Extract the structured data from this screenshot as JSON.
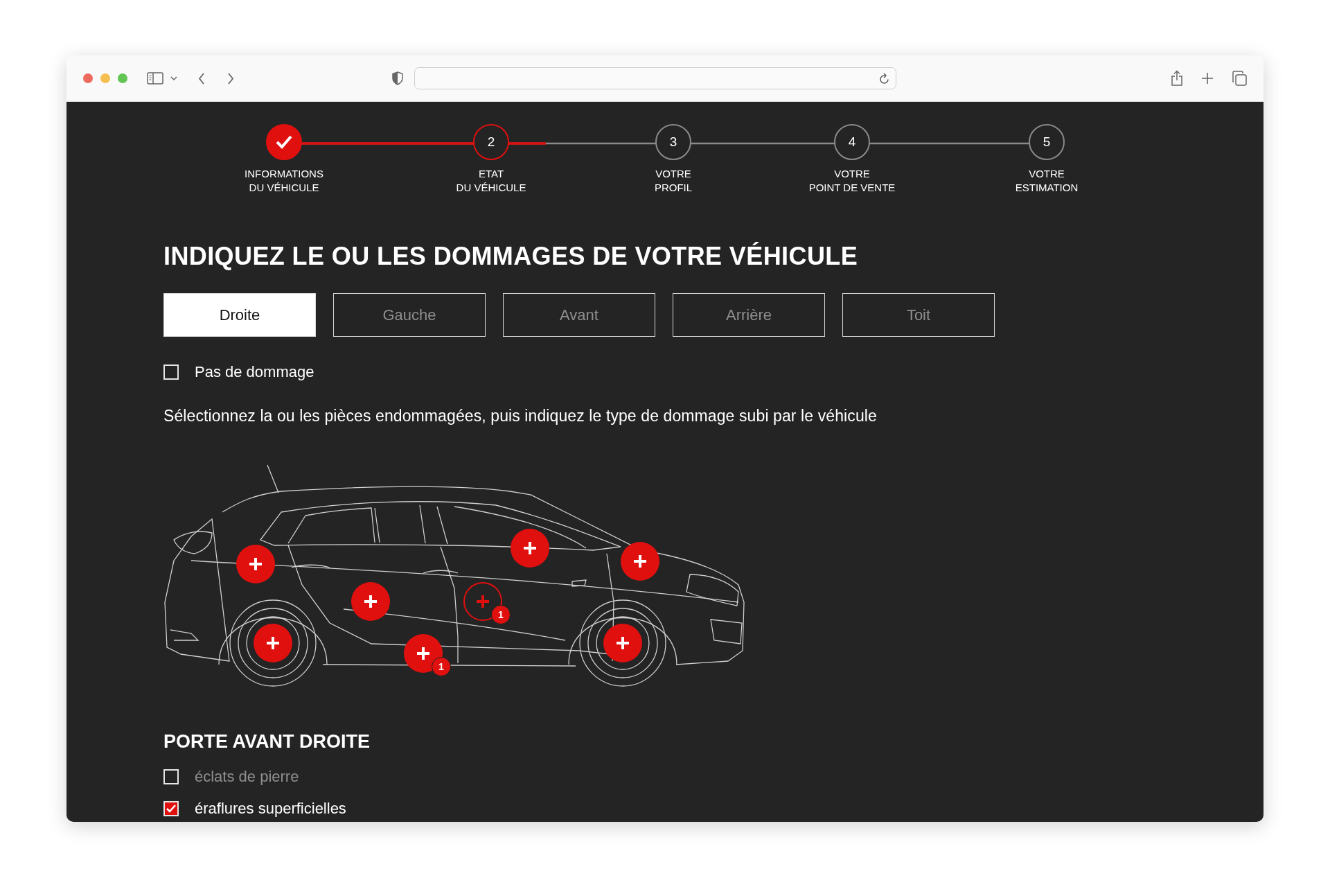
{
  "steps": [
    {
      "label": [
        "INFORMATIONS",
        "DU VÉHICULE"
      ],
      "completed": true,
      "selected": false
    },
    {
      "number": "2",
      "label": [
        "ETAT",
        "DU VÉHICULE"
      ],
      "completed": false,
      "selected": true
    },
    {
      "number": "3",
      "label": [
        "VOTRE",
        "PROFIL"
      ],
      "completed": false,
      "selected": false
    },
    {
      "number": "4",
      "label": [
        "VOTRE",
        "POINT DE VENTE"
      ],
      "completed": false,
      "selected": false
    },
    {
      "number": "5",
      "label": [
        "VOTRE",
        "ESTIMATION"
      ],
      "completed": false,
      "selected": false
    }
  ],
  "title": "INDIQUEZ LE OU LES DOMMAGES DE VOTRE VÉHICULE",
  "tabs": [
    {
      "label": "Droite",
      "selected": true
    },
    {
      "label": "Gauche",
      "selected": false
    },
    {
      "label": "Avant",
      "selected": false
    },
    {
      "label": "Arrière",
      "selected": false
    },
    {
      "label": "Toit",
      "selected": false
    }
  ],
  "no_damage": {
    "label": "Pas de dommage",
    "checked": false
  },
  "instruction": "Sélectionnez la ou les pièces endommagées, puis indiquez le type de dommage subi par le véhicule",
  "hotspots": [
    {
      "selected": false
    },
    {
      "selected": false
    },
    {
      "selected": false
    },
    {
      "selected": false,
      "badge": "1"
    },
    {
      "selected": true,
      "badge": "1"
    },
    {
      "selected": false
    },
    {
      "selected": false
    },
    {
      "selected": false
    }
  ],
  "section": {
    "title": "PORTE AVANT DROITE",
    "options": [
      {
        "label": "éclats de pierre",
        "checked": false
      },
      {
        "label": "éraflures superficielles",
        "checked": true
      }
    ]
  }
}
